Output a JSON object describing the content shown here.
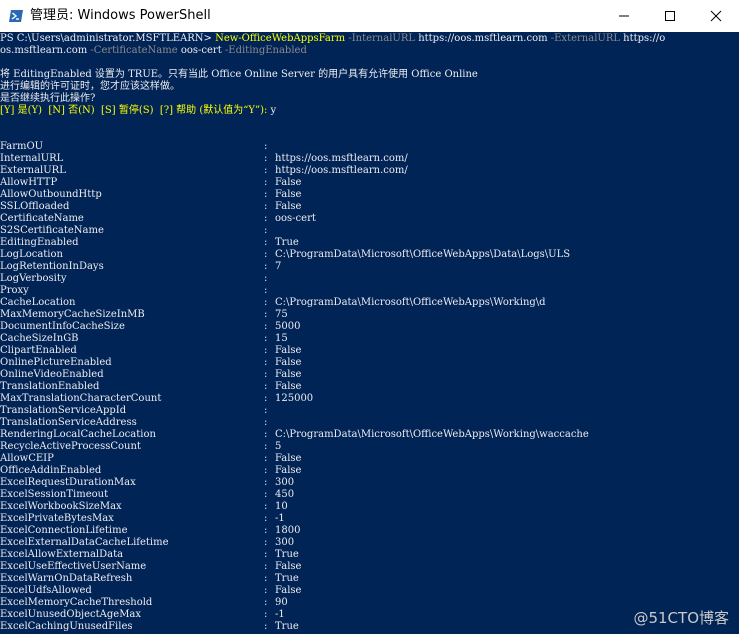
{
  "window": {
    "title": "管理员: Windows PowerShell"
  },
  "command": {
    "prompt": "PS C:\\Users\\administrator.MSFTLEARN> ",
    "cmdlet": "New-OfficeWebAppsFarm",
    "p1": " -InternalURL ",
    "v1": "https://oos.msftlearn.com",
    "p2": " -ExternalURL ",
    "v2": "https://o",
    "cont": "os.msftlearn.com",
    "p3": " -CertificateName ",
    "v3": "oos-cert",
    "p4": " -EditingEnabled"
  },
  "confirm": {
    "line1": "将 EditingEnabled 设置为 TRUE。只有当此 Office Online Server 的用户具有允许使用 Office Online",
    "line2": "进行编辑的许可证时，您才应该这样做。",
    "line3": "是否继续执行此操作?",
    "choices": "[Y] 是(Y)  [N] 否(N)  [S] 暂停(S)  [?] 帮助 (默认值为“Y”): ",
    "answer": "y"
  },
  "properties": [
    {
      "name": "FarmOU",
      "value": ""
    },
    {
      "name": "InternalURL",
      "value": "https://oos.msftlearn.com/"
    },
    {
      "name": "ExternalURL",
      "value": "https://oos.msftlearn.com/"
    },
    {
      "name": "AllowHTTP",
      "value": "False"
    },
    {
      "name": "AllowOutboundHttp",
      "value": "False"
    },
    {
      "name": "SSLOffloaded",
      "value": "False"
    },
    {
      "name": "CertificateName",
      "value": "oos-cert"
    },
    {
      "name": "S2SCertificateName",
      "value": ""
    },
    {
      "name": "EditingEnabled",
      "value": "True"
    },
    {
      "name": "LogLocation",
      "value": "C:\\ProgramData\\Microsoft\\OfficeWebApps\\Data\\Logs\\ULS"
    },
    {
      "name": "LogRetentionInDays",
      "value": "7"
    },
    {
      "name": "LogVerbosity",
      "value": ""
    },
    {
      "name": "Proxy",
      "value": ""
    },
    {
      "name": "CacheLocation",
      "value": "C:\\ProgramData\\Microsoft\\OfficeWebApps\\Working\\d"
    },
    {
      "name": "MaxMemoryCacheSizeInMB",
      "value": "75"
    },
    {
      "name": "DocumentInfoCacheSize",
      "value": "5000"
    },
    {
      "name": "CacheSizeInGB",
      "value": "15"
    },
    {
      "name": "ClipartEnabled",
      "value": "False"
    },
    {
      "name": "OnlinePictureEnabled",
      "value": "False"
    },
    {
      "name": "OnlineVideoEnabled",
      "value": "False"
    },
    {
      "name": "TranslationEnabled",
      "value": "False"
    },
    {
      "name": "MaxTranslationCharacterCount",
      "value": "125000"
    },
    {
      "name": "TranslationServiceAppId",
      "value": ""
    },
    {
      "name": "TranslationServiceAddress",
      "value": ""
    },
    {
      "name": "RenderingLocalCacheLocation",
      "value": "C:\\ProgramData\\Microsoft\\OfficeWebApps\\Working\\waccache"
    },
    {
      "name": "RecycleActiveProcessCount",
      "value": "5"
    },
    {
      "name": "AllowCEIP",
      "value": "False"
    },
    {
      "name": "OfficeAddinEnabled",
      "value": "False"
    },
    {
      "name": "ExcelRequestDurationMax",
      "value": "300"
    },
    {
      "name": "ExcelSessionTimeout",
      "value": "450"
    },
    {
      "name": "ExcelWorkbookSizeMax",
      "value": "10"
    },
    {
      "name": "ExcelPrivateBytesMax",
      "value": "-1"
    },
    {
      "name": "ExcelConnectionLifetime",
      "value": "1800"
    },
    {
      "name": "ExcelExternalDataCacheLifetime",
      "value": "300"
    },
    {
      "name": "ExcelAllowExternalData",
      "value": "True"
    },
    {
      "name": "ExcelUseEffectiveUserName",
      "value": "False"
    },
    {
      "name": "ExcelWarnOnDataRefresh",
      "value": "True"
    },
    {
      "name": "ExcelUdfsAllowed",
      "value": "False"
    },
    {
      "name": "ExcelMemoryCacheThreshold",
      "value": "90"
    },
    {
      "name": "ExcelUnusedObjectAgeMax",
      "value": "-1"
    },
    {
      "name": "ExcelCachingUnusedFiles",
      "value": "True"
    }
  ],
  "watermark": "@51CTO博客",
  "colors": {
    "console_bg": "#012456",
    "text": "#eeedf0",
    "cmdlet": "#ffff00",
    "param": "#8c8c8c"
  }
}
